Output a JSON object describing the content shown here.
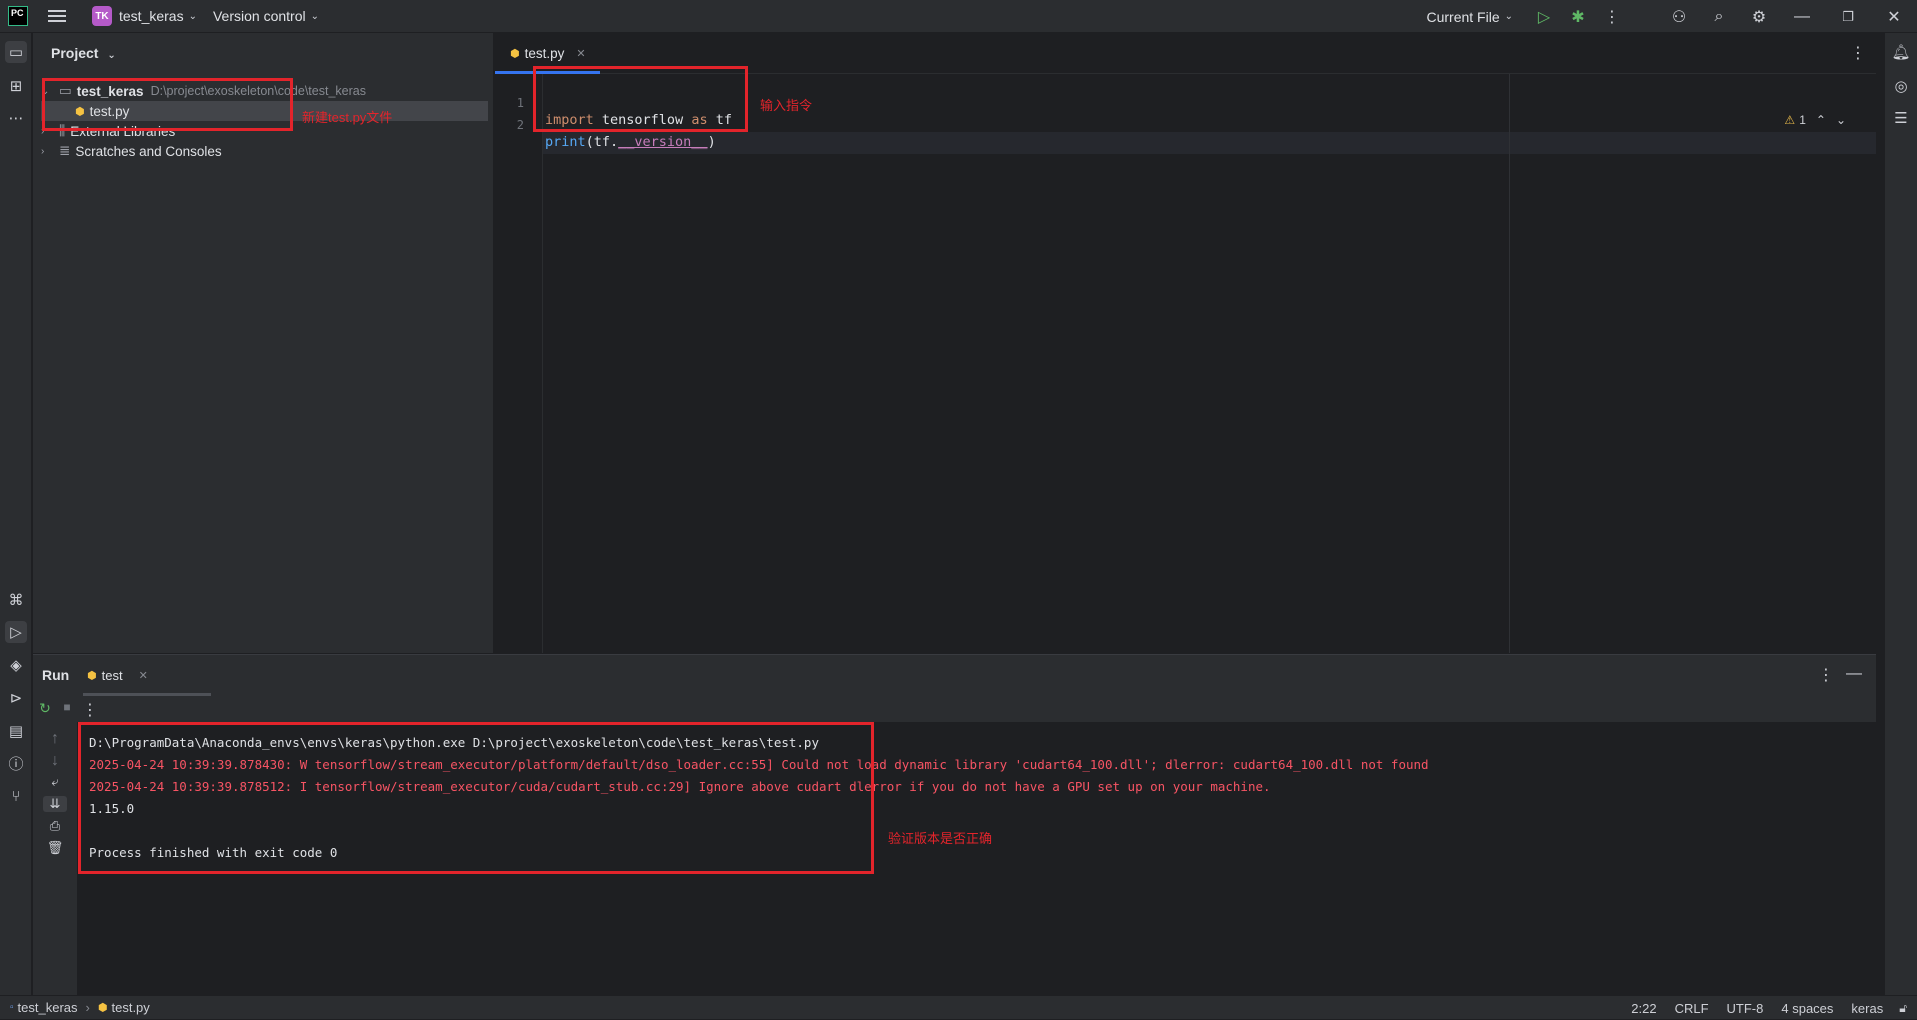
{
  "titlebar": {
    "logo_text": "PC",
    "project_badge": "TK",
    "project_name": "test_keras",
    "vcs_label": "Version control",
    "run_config": "Current File"
  },
  "project_panel": {
    "title": "Project",
    "root_name": "test_keras",
    "root_path": "D:\\project\\exoskeleton\\code\\test_keras",
    "file_name": "test.py",
    "external_libraries": "External Libraries",
    "scratches": "Scratches and Consoles"
  },
  "editor": {
    "tab_label": "test.py",
    "lines": [
      {
        "num": "1",
        "kw1": "import",
        "t1": " tensorflow ",
        "kw2": "as",
        "t2": " tf"
      },
      {
        "num": "2",
        "fn": "print",
        "p1": "(tf.",
        "dunder": "__version__",
        "p2": ")"
      }
    ],
    "warning_count": "1"
  },
  "run_panel": {
    "title": "Run",
    "tab_label": "test",
    "output": [
      {
        "text": "D:\\ProgramData\\Anaconda_envs\\envs\\keras\\python.exe D:\\project\\exoskeleton\\code\\test_keras\\test.py",
        "type": "normal"
      },
      {
        "text": "2025-04-24 10:39:39.878430: W tensorflow/stream_executor/platform/default/dso_loader.cc:55] Could not load dynamic library 'cudart64_100.dll'; dlerror: cudart64_100.dll not found",
        "type": "error"
      },
      {
        "text": "2025-04-24 10:39:39.878512: I tensorflow/stream_executor/cuda/cudart_stub.cc:29] Ignore above cudart dlerror if you do not have a GPU set up on your machine.",
        "type": "error"
      },
      {
        "text": "1.15.0",
        "type": "normal"
      },
      {
        "text": "",
        "type": "normal"
      },
      {
        "text": "Process finished with exit code 0",
        "type": "normal"
      }
    ]
  },
  "annotations": {
    "new_file": "新建test.py文件",
    "input_cmd": "输入指令",
    "verify": "验证版本是否正确"
  },
  "statusbar": {
    "crumb_project": "test_keras",
    "crumb_file": "test.py",
    "position": "2:22",
    "line_sep": "CRLF",
    "encoding": "UTF-8",
    "indent": "4 spaces",
    "interpreter": "keras"
  },
  "colors": {
    "accent": "#3574f0",
    "annotation": "#e3242b",
    "error_text": "#f75464"
  }
}
